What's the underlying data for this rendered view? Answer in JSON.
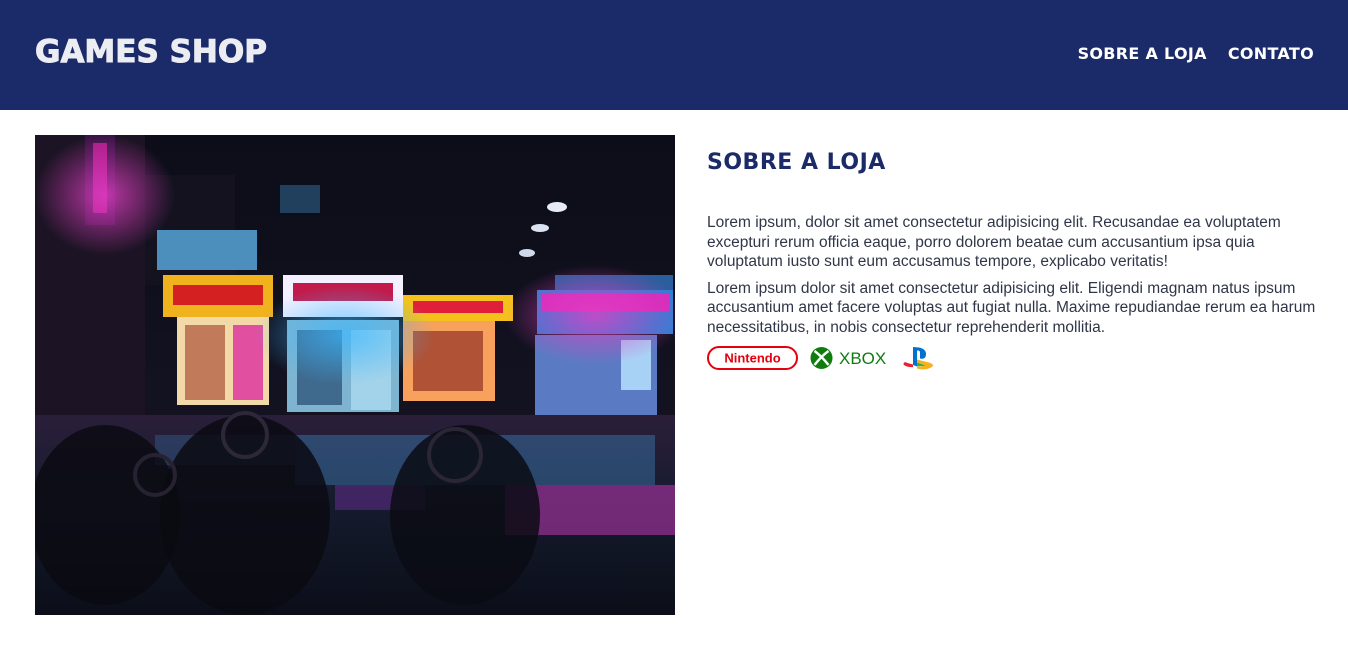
{
  "header": {
    "logo": "GAMES SHOP",
    "nav": [
      "SOBRE A LOJA",
      "CONTATO"
    ]
  },
  "about": {
    "title": "SOBRE A LOJA",
    "paragraphs": [
      "Lorem ipsum, dolor sit amet consectetur adipisicing elit. Recusandae ea voluptatem excepturi rerum officia eaque, porro dolorem beatae cum accusantium ipsa quia voluptatum iusto sunt eum accusamus tempore, explicabo veritatis!",
      "Lorem ipsum dolor sit amet consectetur adipisicing elit. Eligendi magnam natus ipsum accusantium amet facere voluptas aut fugiat nulla. Maxime repudiandae rerum ea harum necessitatibus, in nobis consectetur reprehenderit mollitia."
    ]
  },
  "consoles": {
    "nintendo": "Nintendo",
    "xbox": "XBOX",
    "playstation_icon": "playstation-logo"
  },
  "colors": {
    "header_bg": "#1b2a68",
    "title": "#1b2a68",
    "nintendo_red": "#e4000f",
    "xbox_green": "#107c10"
  }
}
